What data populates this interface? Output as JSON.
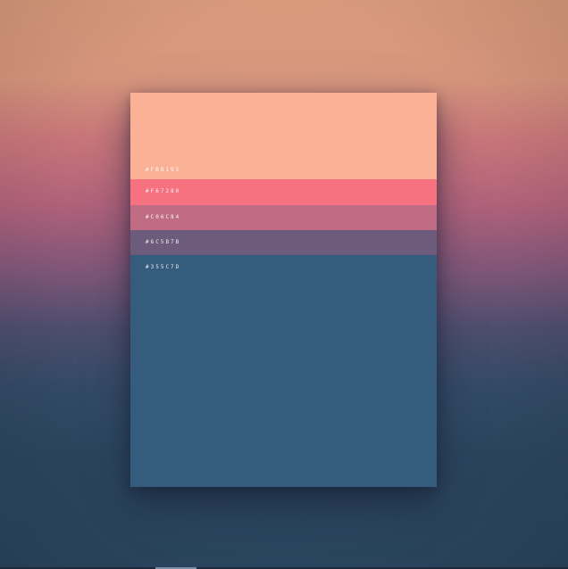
{
  "palette": {
    "swatches": [
      {
        "hex": "#FBB195",
        "label": "#FBB195"
      },
      {
        "hex": "#F67280",
        "label": "#F67280"
      },
      {
        "hex": "#C06C84",
        "label": "#C06C84"
      },
      {
        "hex": "#6C5B7B",
        "label": "#6C5B7B"
      },
      {
        "hex": "#355C7D",
        "label": "#355C7D"
      }
    ]
  }
}
